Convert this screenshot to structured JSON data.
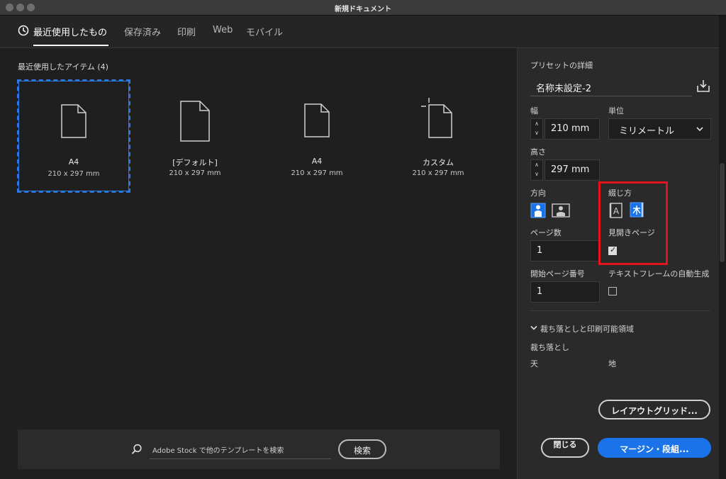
{
  "window": {
    "title": "新規ドキュメント"
  },
  "tabs": [
    {
      "label": "最近使用したもの",
      "active": true
    },
    {
      "label": "保存済み"
    },
    {
      "label": "印刷"
    },
    {
      "label": "Web"
    },
    {
      "label": "モバイル"
    }
  ],
  "recent": {
    "heading": "最近使用したアイテム (4)",
    "items": [
      {
        "name": "A4",
        "size": "210 x 297 mm",
        "selected": true,
        "icon": "document-icon"
      },
      {
        "name": "[デフォルト]",
        "size": "210 x 297 mm",
        "icon": "document-icon"
      },
      {
        "name": "A4",
        "size": "210 x 297 mm",
        "icon": "document-icon"
      },
      {
        "name": "カスタム",
        "size": "210 x 297 mm",
        "icon": "custom-document-icon"
      }
    ]
  },
  "search": {
    "placeholder": "Adobe Stock で他のテンプレートを検索",
    "button": "検索"
  },
  "preset": {
    "heading": "プリセットの詳細",
    "name": "名称未設定-2",
    "width_label": "幅",
    "width_value": "210 mm",
    "unit_label": "単位",
    "unit_value": "ミリメートル",
    "height_label": "高さ",
    "height_value": "297 mm",
    "orientation_label": "方向",
    "binding_label": "綴じ方",
    "pages_label": "ページ数",
    "pages_value": "1",
    "facing_label": "見開きページ",
    "facing_checked": true,
    "start_label": "開始ページ番号",
    "start_value": "1",
    "textframe_label": "テキストフレームの自動生成",
    "textframe_checked": false,
    "bleed_section": "裁ち落としと印刷可能領域",
    "bleed_label": "裁ち落とし",
    "top_label": "天",
    "bottom_label": "地"
  },
  "buttons": {
    "layout_grid": "レイアウトグリッド...",
    "close": "閉じる",
    "margins": "マージン・段組..."
  },
  "colors": {
    "accent": "#1a73e8",
    "highlight": "#e3141e",
    "selection": "#2b78e4"
  }
}
